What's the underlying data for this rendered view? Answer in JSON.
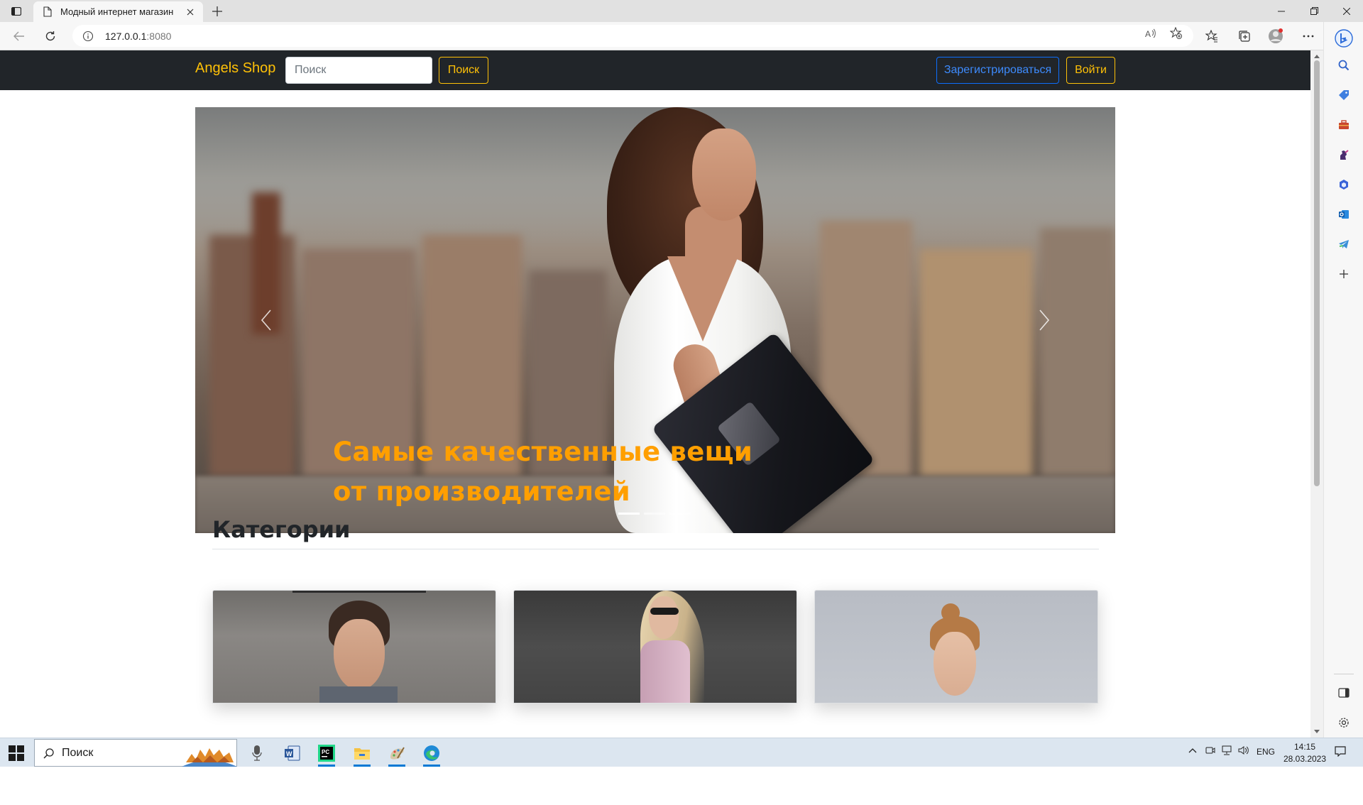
{
  "browser": {
    "tab_title": "Модный интернет магазин",
    "url_host": "127.0.0.1",
    "url_port": ":8080"
  },
  "site": {
    "brand": "Angels Shop",
    "search_placeholder": "Поиск",
    "search_button": "Поиск",
    "register_button": "Зарегистрироваться",
    "login_button": "Войти",
    "accent_color": "#ffc107",
    "primary_color": "#0d6efd"
  },
  "carousel": {
    "caption_line1": "Самые качественные вещи",
    "caption_line2": "от производителей",
    "caption_color": "#ff9f00",
    "slides_total": 3,
    "active_slide": 1
  },
  "categories": {
    "title": "Категории",
    "cards": [
      {
        "image": "man-portrait"
      },
      {
        "image": "woman-sunglasses-portrait"
      },
      {
        "image": "woman-hair-bun-portrait"
      }
    ]
  },
  "taskbar": {
    "search_label": "Поиск",
    "language": "ENG",
    "time": "14:15",
    "date": "28.03.2023"
  },
  "icons": {
    "sidebar": [
      "search-icon",
      "shopping-tag-icon",
      "tools-icon",
      "games-icon",
      "office-icon",
      "outlook-icon",
      "telegram-icon",
      "add-icon",
      "split-screen-icon",
      "settings-icon"
    ]
  }
}
